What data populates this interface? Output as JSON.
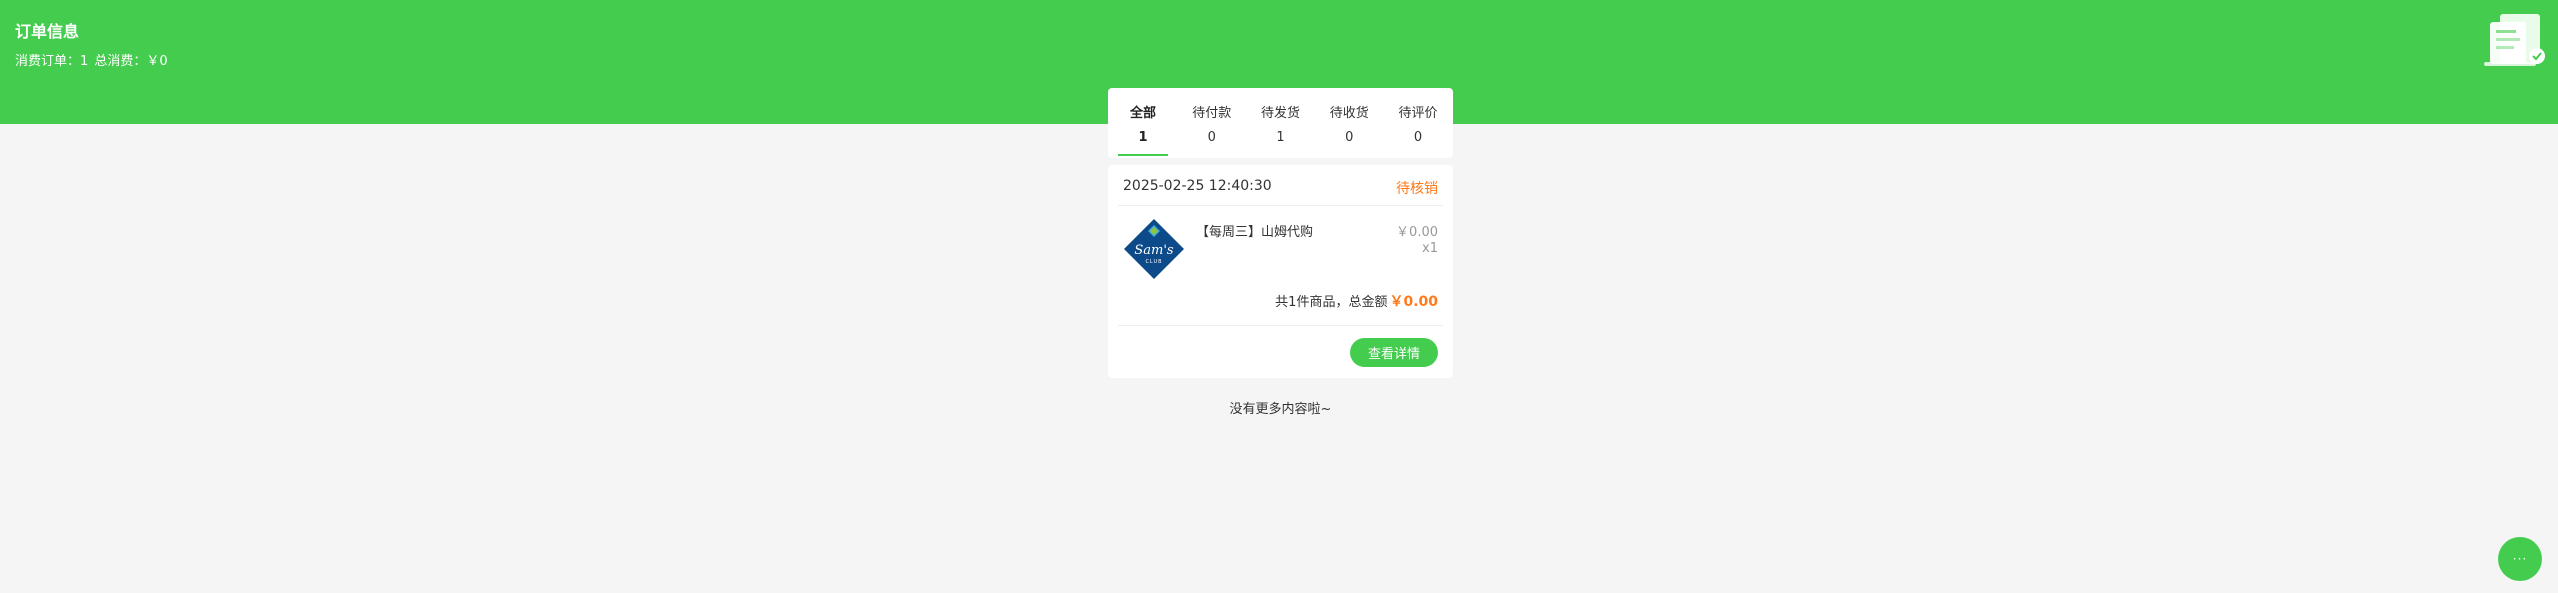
{
  "header": {
    "title": "订单信息",
    "order_count_label": "消费订单：1",
    "total_spend_label": "总消费：￥0"
  },
  "tabs": [
    {
      "label": "全部",
      "count": "1",
      "active": true
    },
    {
      "label": "待付款",
      "count": "0",
      "active": false
    },
    {
      "label": "待发货",
      "count": "1",
      "active": false
    },
    {
      "label": "待收货",
      "count": "0",
      "active": false
    },
    {
      "label": "待评价",
      "count": "0",
      "active": false
    }
  ],
  "order": {
    "date": "2025-02-25 12:40:30",
    "status": "待核销",
    "product": {
      "name": "【每周三】山姆代购",
      "price": "￥0.00",
      "qty": "x1",
      "logo_text": "Sam's",
      "logo_subtext": "CLUB"
    },
    "total_prefix": "共1件商品，总金额",
    "total_amount": "￥0.00",
    "detail_button": "查看详情"
  },
  "footer": {
    "no_more": "没有更多内容啦~"
  },
  "fab": {
    "icon": "more-dots-icon",
    "glyph": "···"
  },
  "colors": {
    "brand_green": "#44cc4f",
    "accent_orange": "#ff7a1a",
    "page_bg": "#f5f5f5"
  }
}
